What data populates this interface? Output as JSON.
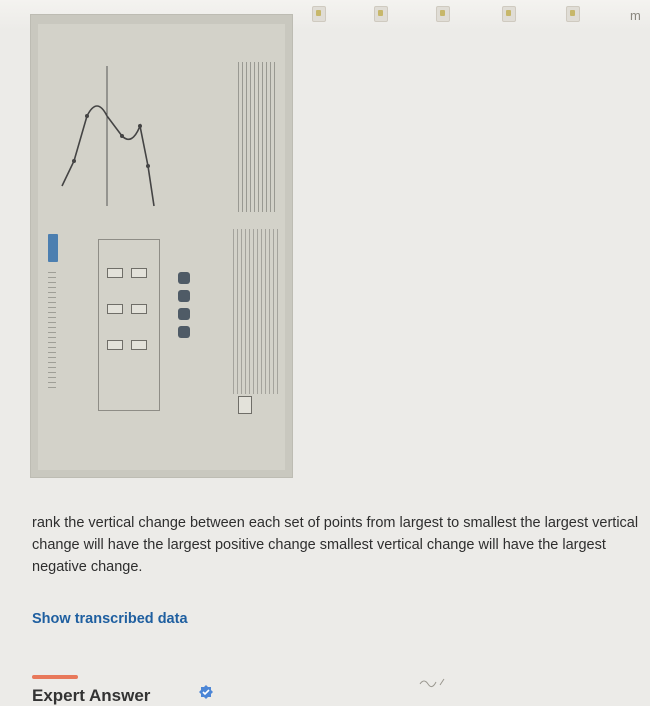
{
  "question": {
    "text": "rank the vertical change between each set of points from largest to smallest the largest vertical\nchange will have the largest positive change smallest vertical change will have the largest\nnegative change."
  },
  "links": {
    "show_transcribed_data": "Show transcribed data"
  },
  "expert_answer": {
    "heading": "Expert Answer"
  },
  "icons": {
    "top_right_glyph": "m",
    "verified_badge": "verified-badge-icon"
  },
  "colors": {
    "link": "#1f5fa0",
    "accent_orange": "#e8785a",
    "badge_blue": "#4c86d6"
  }
}
